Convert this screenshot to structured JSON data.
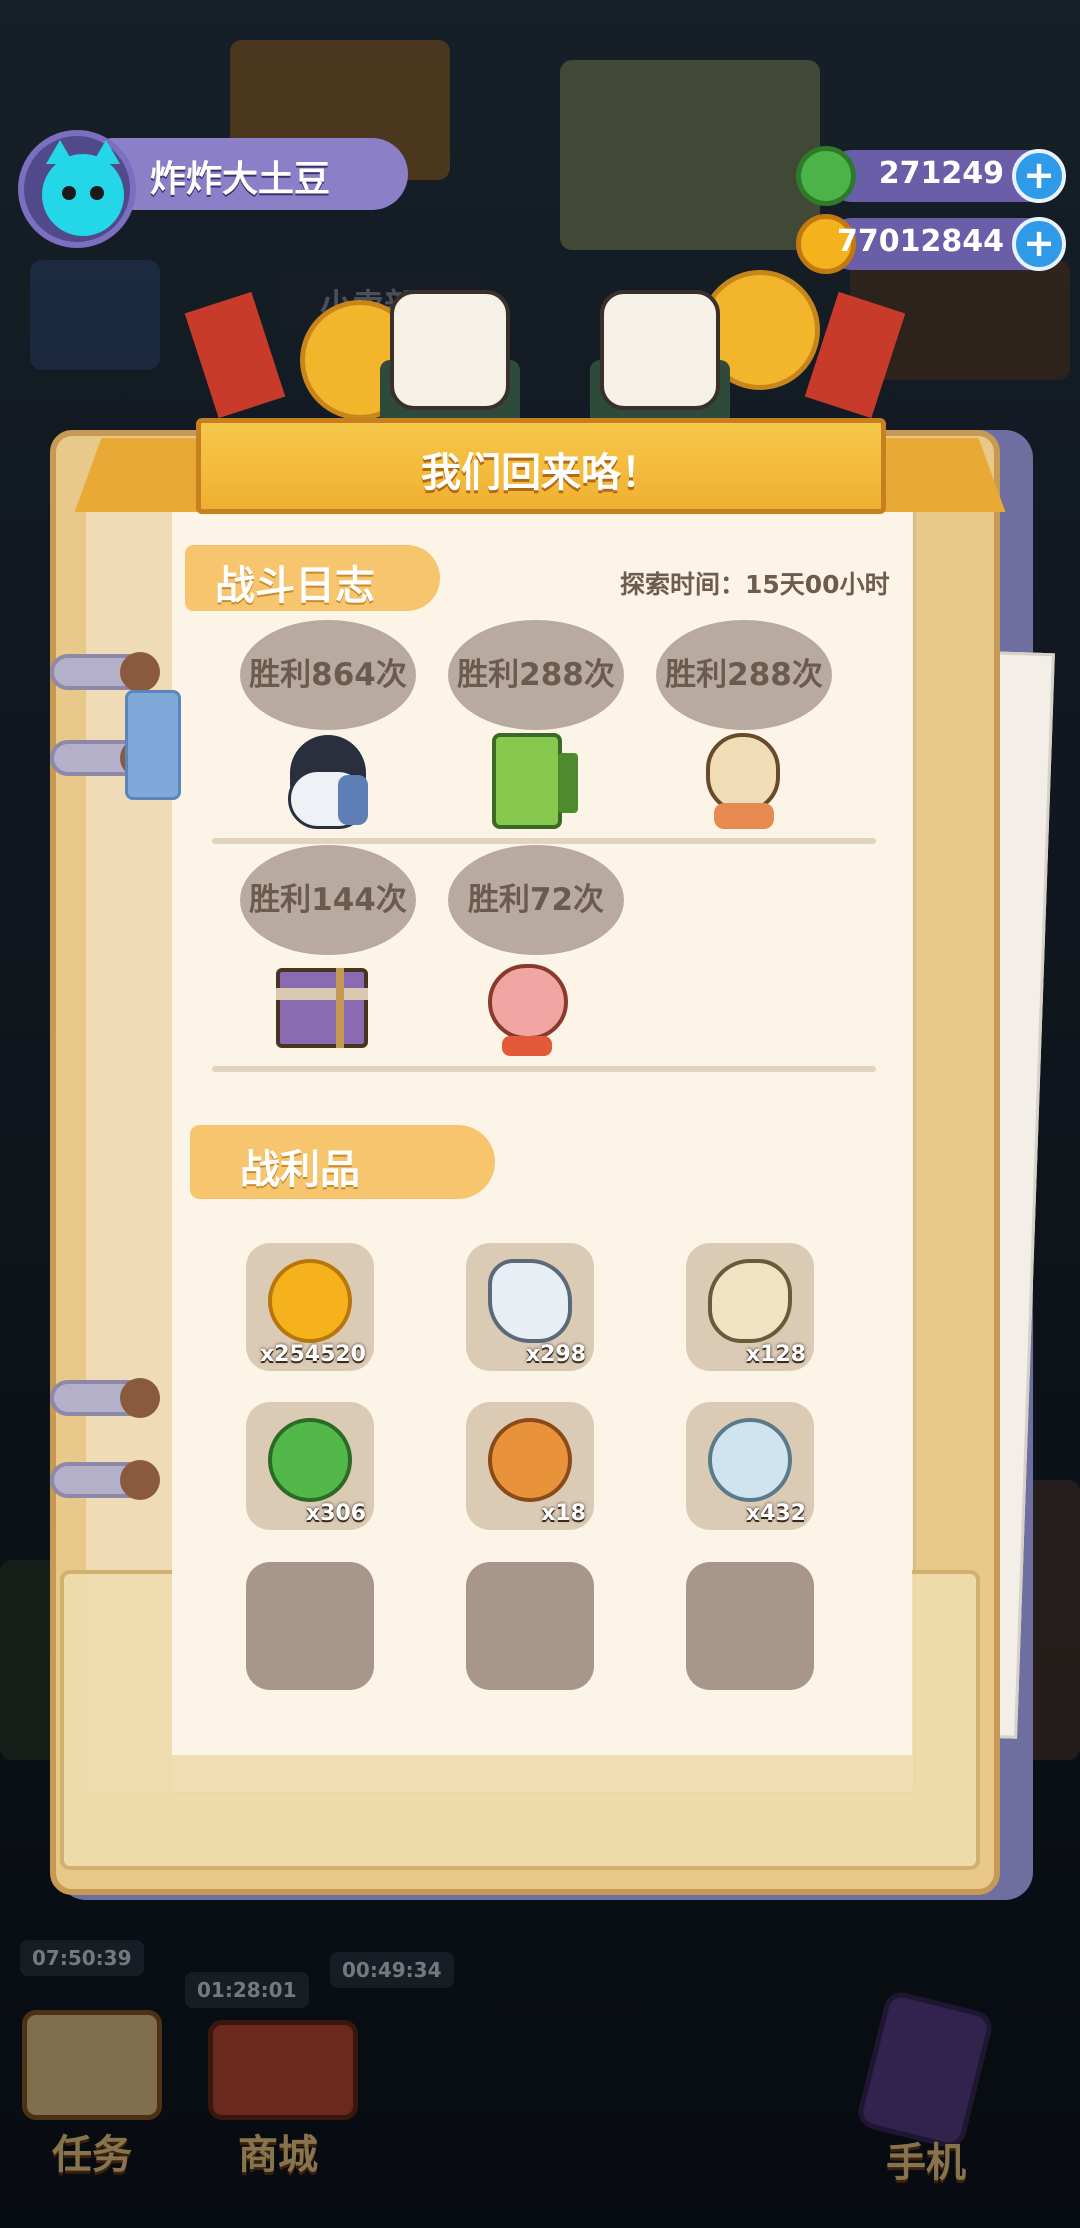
{
  "player": {
    "name": "炸炸大土豆"
  },
  "currency": [
    {
      "icon": "green-gem-icon",
      "value": "271249"
    },
    {
      "icon": "gold-coin-icon",
      "value": "77012844"
    }
  ],
  "dialog": {
    "title": "我们回来咯！",
    "battle_log_label": "战斗日志",
    "explore_time": "探索时间：15天00小时",
    "victories": [
      {
        "text": "胜利864次",
        "creature": "penguin-bird-icon"
      },
      {
        "text": "胜利288次",
        "creature": "green-bamboo-box-icon"
      },
      {
        "text": "胜利288次",
        "creature": "peanut-creature-icon"
      },
      {
        "text": "胜利144次",
        "creature": "wooden-crate-creature-icon"
      },
      {
        "text": "胜利72次",
        "creature": "pink-radish-creature-icon"
      }
    ],
    "loot_label": "战利品",
    "loot": [
      {
        "icon": "gold-coin-icon",
        "qty": "x254520",
        "color": "#f5b21c"
      },
      {
        "icon": "bone-icon",
        "qty": "x298",
        "color": "#e8eef3"
      },
      {
        "icon": "pistachio-icon",
        "qty": "x128",
        "color": "#f0e3c3"
      },
      {
        "icon": "green-gem-icon",
        "qty": "x306",
        "color": "#52b84a"
      },
      {
        "icon": "cookie-icon",
        "qty": "x18",
        "color": "#e8923a"
      },
      {
        "icon": "pearl-icon",
        "qty": "x432",
        "color": "#cfe4ef"
      }
    ],
    "empty_slots": 3
  },
  "background": {
    "shop_sign": "小卖部",
    "timers": [
      "07:50:39",
      "01:28:01",
      "00:49:34"
    ],
    "nav": [
      {
        "label": "任务",
        "icon": "task-book-icon"
      },
      {
        "label": "商城",
        "icon": "shop-icon"
      },
      {
        "label": "手机",
        "icon": "phone-icon"
      }
    ]
  }
}
